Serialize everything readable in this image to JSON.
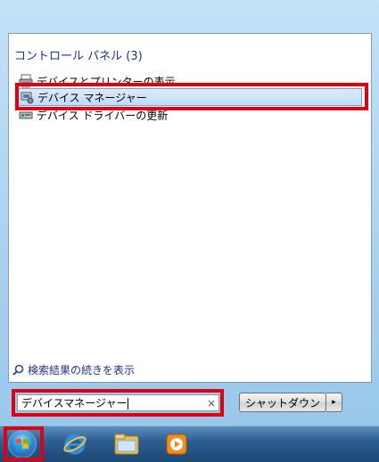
{
  "start_menu": {
    "section_title": "コントロール パネル (3)",
    "results": [
      {
        "label": "デバイスとプリンターの表示",
        "icon": "printer-icon"
      },
      {
        "label": "デバイス マネージャー",
        "icon": "device-manager-icon"
      },
      {
        "label": "デバイス ドライバーの更新",
        "icon": "driver-update-icon"
      }
    ],
    "more_results_link": "検索結果の続きを表示",
    "search": {
      "value": "デバイスマネージャー",
      "clear_glyph": "×"
    },
    "shutdown": {
      "label": "シャットダウン",
      "arrow_glyph": "▸"
    }
  },
  "taskbar": {
    "items": [
      {
        "icon": "windows-start-orb-icon"
      },
      {
        "icon": "internet-explorer-icon"
      },
      {
        "icon": "windows-explorer-folder-icon"
      },
      {
        "icon": "media-player-icon"
      }
    ]
  },
  "colors": {
    "highlight_red": "#e00012",
    "link_blue": "#1e3287"
  }
}
